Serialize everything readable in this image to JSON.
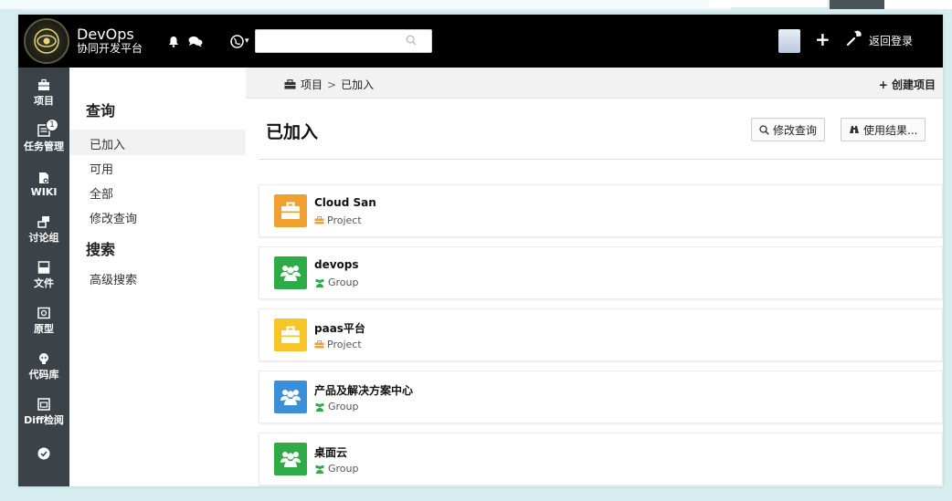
{
  "header": {
    "brand_name": "DevOps",
    "brand_sub": "协同开发平台",
    "search_placeholder": "",
    "return_login": "返回登录"
  },
  "rail": [
    {
      "label": "项目",
      "icon": "briefcase-icon"
    },
    {
      "label": "任务管理",
      "icon": "task-icon",
      "badge": "1"
    },
    {
      "label": "WIKI",
      "icon": "wiki-icon"
    },
    {
      "label": "讨论组",
      "icon": "discussion-icon"
    },
    {
      "label": "文件",
      "icon": "file-icon"
    },
    {
      "label": "原型",
      "icon": "prototype-icon"
    },
    {
      "label": "代码库",
      "icon": "github-icon"
    },
    {
      "label": "Diff检阅",
      "icon": "diff-icon"
    },
    {
      "label": "",
      "icon": "check-icon"
    }
  ],
  "filter": {
    "query_heading": "查询",
    "items": [
      "已加入",
      "可用",
      "全部",
      "修改查询"
    ],
    "search_heading": "搜索",
    "advanced": "高级搜索"
  },
  "breadcrumb": {
    "root": "项目",
    "separator": ">",
    "current": "已加入"
  },
  "create_project": "+ 创建项目",
  "page_title": "已加入",
  "buttons": {
    "modify_query": "修改查询",
    "use_results": "使用结果..."
  },
  "results": [
    {
      "title": "Cloud San",
      "type": "Project",
      "tile_color": "#f0a030",
      "icon": "briefcase-icon"
    },
    {
      "title": "devops",
      "type": "Group",
      "tile_color": "#2eaa49",
      "icon": "group-icon"
    },
    {
      "title": "paas平台",
      "type": "Project",
      "tile_color": "#f7c52a",
      "icon": "briefcase-icon"
    },
    {
      "title": "产品及解决方案中心",
      "type": "Group",
      "tile_color": "#3a8fd9",
      "icon": "group-icon"
    },
    {
      "title": "桌面云",
      "type": "Group",
      "tile_color": "#2eaa49",
      "icon": "group-icon"
    }
  ]
}
